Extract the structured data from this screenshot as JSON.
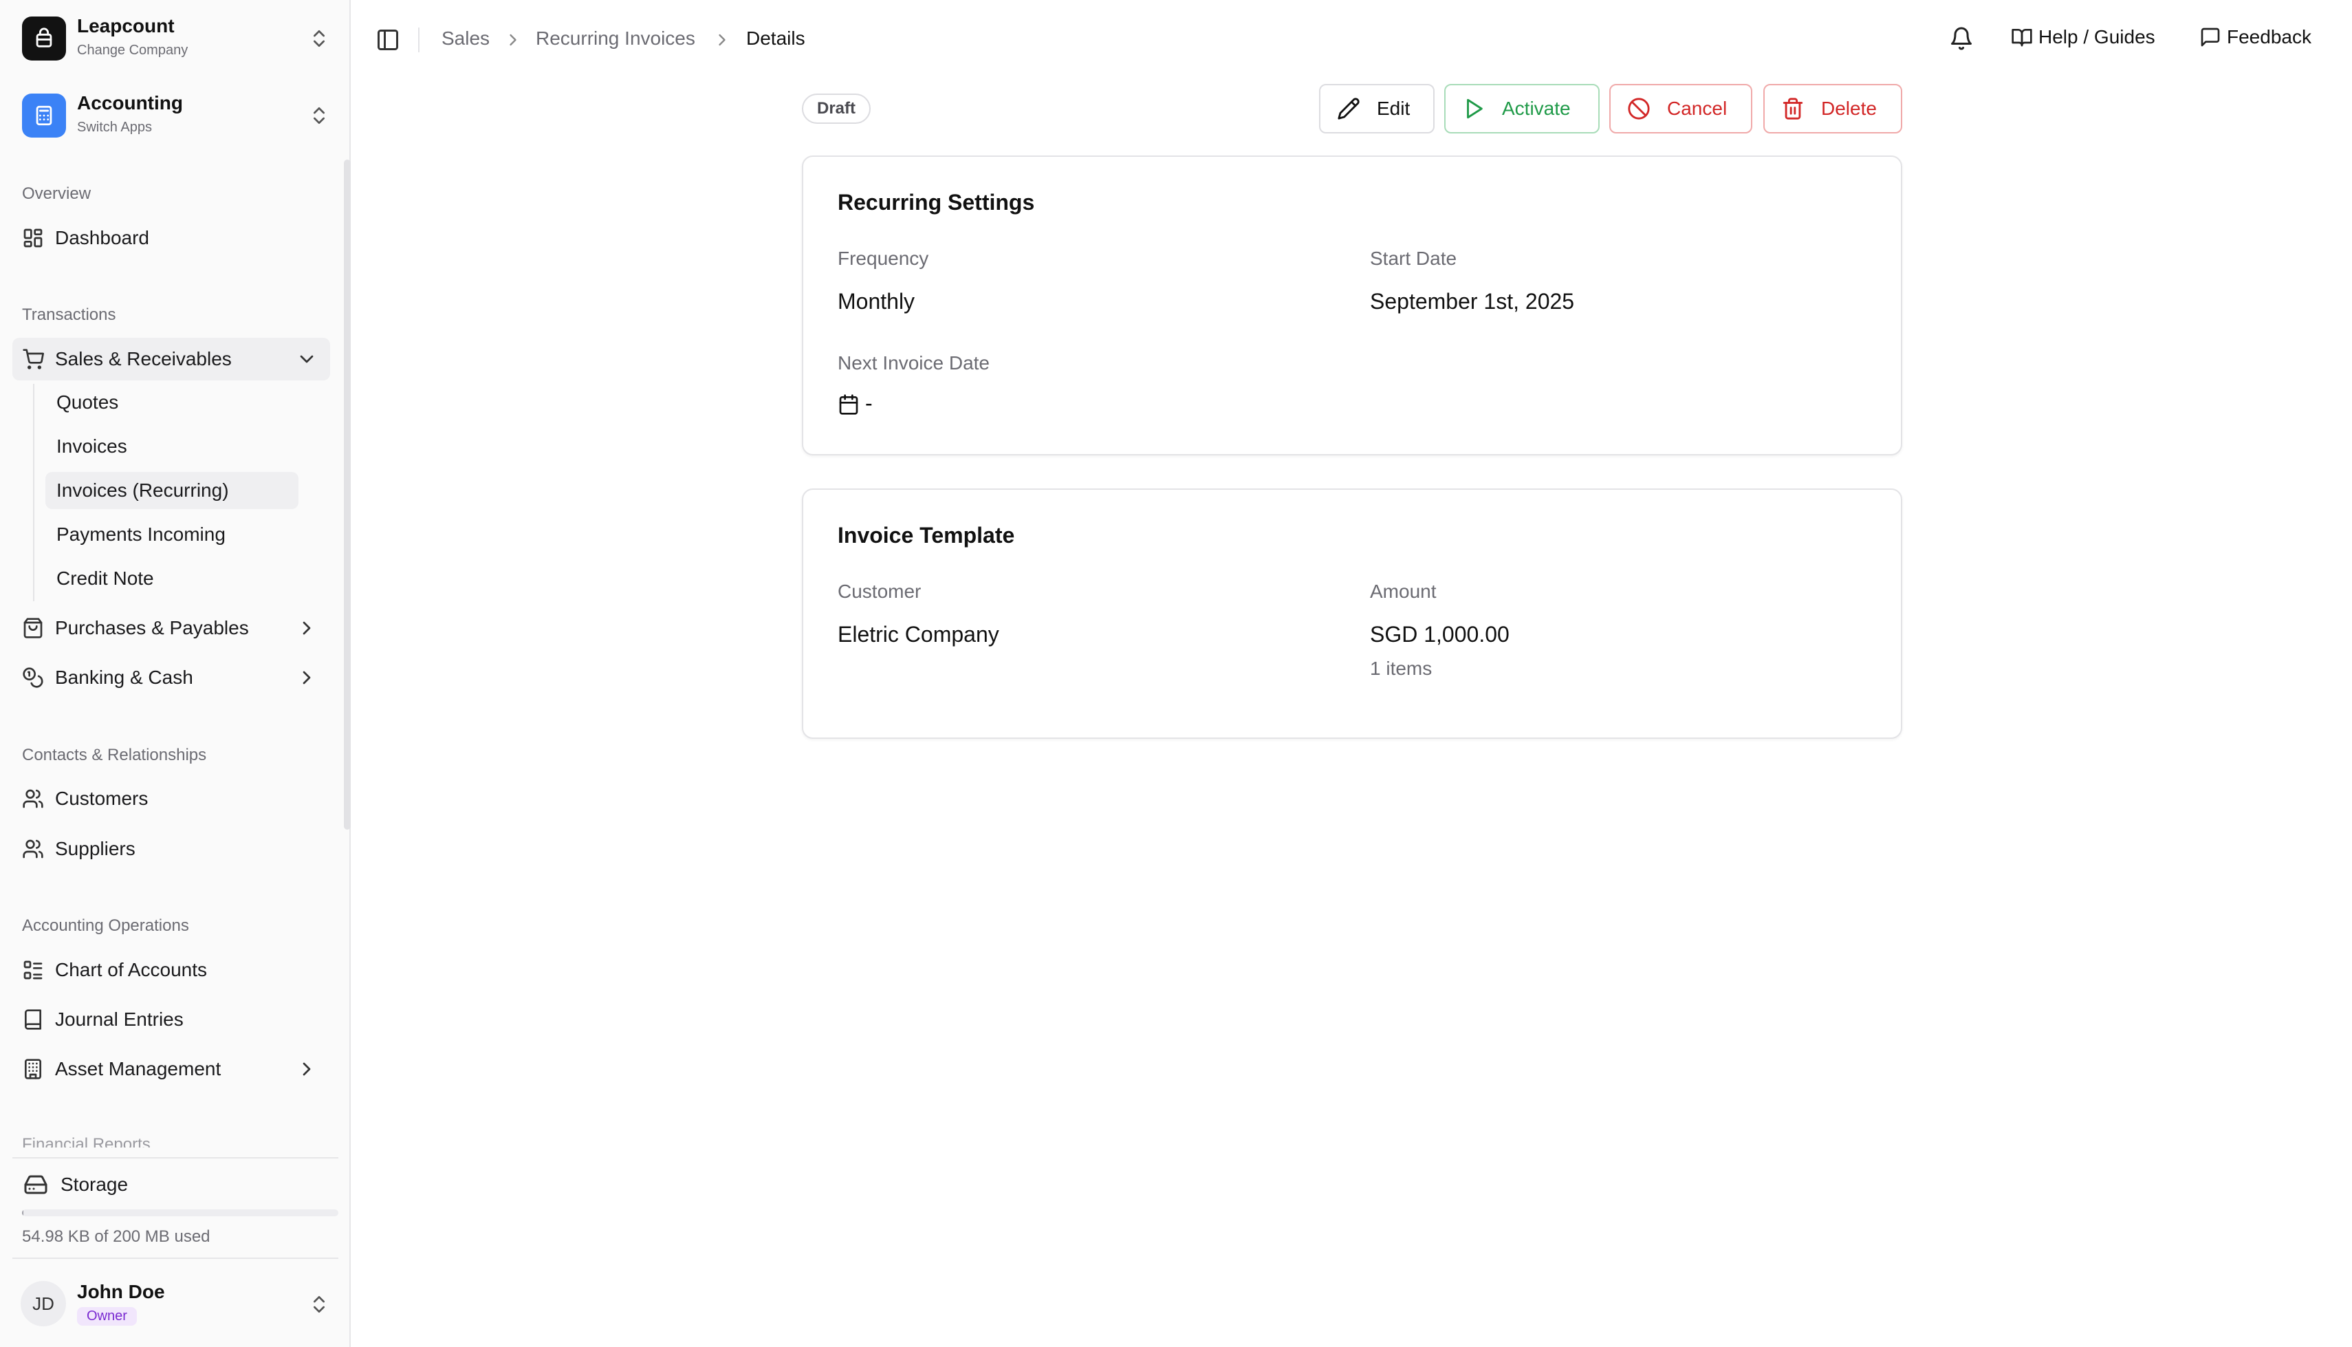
{
  "company": {
    "name": "Leapcount",
    "action": "Change Company"
  },
  "app": {
    "name": "Accounting",
    "action": "Switch Apps"
  },
  "sidebar": {
    "overview_label": "Overview",
    "dashboard": "Dashboard",
    "transactions_label": "Transactions",
    "sales": {
      "label": "Sales & Receivables",
      "items": [
        "Quotes",
        "Invoices",
        "Invoices (Recurring)",
        "Payments Incoming",
        "Credit Note"
      ]
    },
    "purchases": "Purchases & Payables",
    "banking": "Banking & Cash",
    "contacts_label": "Contacts & Relationships",
    "customers": "Customers",
    "suppliers": "Suppliers",
    "operations_label": "Accounting Operations",
    "chart_of_accounts": "Chart of Accounts",
    "journal_entries": "Journal Entries",
    "asset_management": "Asset Management",
    "reports_label_cut": "Financial Reports"
  },
  "storage": {
    "title": "Storage",
    "usage": "54.98 KB of 200 MB used",
    "used_fraction": 0.0003
  },
  "user": {
    "initials": "JD",
    "name": "John Doe",
    "role": "Owner"
  },
  "breadcrumb": {
    "first": "Sales",
    "second": "Recurring Invoices",
    "current": "Details"
  },
  "topbar": {
    "help": "Help / Guides",
    "feedback": "Feedback"
  },
  "status": "Draft",
  "actions": {
    "edit": "Edit",
    "activate": "Activate",
    "cancel": "Cancel",
    "delete": "Delete"
  },
  "recurring": {
    "title": "Recurring Settings",
    "frequency_label": "Frequency",
    "frequency": "Monthly",
    "start_label": "Start Date",
    "start": "September 1st, 2025",
    "next_label": "Next Invoice Date",
    "next": "-"
  },
  "template": {
    "title": "Invoice Template",
    "customer_label": "Customer",
    "customer": "Eletric Company",
    "amount_label": "Amount",
    "amount": "SGD 1,000.00",
    "items": "1 items"
  },
  "colors": {
    "accent_blue": "#3b82f6",
    "activate_green": "#1f9a48",
    "danger_red": "#d22626",
    "owner_purple": "#7a2ad1"
  }
}
